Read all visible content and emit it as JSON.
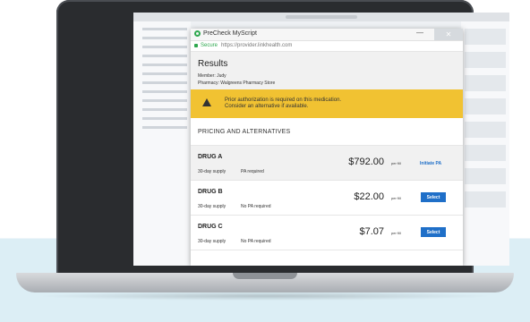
{
  "popup": {
    "app_name": "PreCheck MyScript",
    "minimize": "—",
    "close": "✕",
    "secure_label": "Secure",
    "url": "https://provider.linkhealth.com"
  },
  "results": {
    "title": "Results",
    "member": "Member: Judy",
    "pharmacy": "Pharmacy: Walgreens Pharmacy Store"
  },
  "alert": {
    "line1": "Prior authorization is required on this medication.",
    "line2": "Consider an alternative if available."
  },
  "pricing": {
    "section_title": "PRICING AND ALTERNATIVES",
    "drugs": [
      {
        "name": "DRUG A",
        "supply": "30-day supply",
        "pa": "PA required",
        "price": "$792.00",
        "per": "per fill",
        "action": "Initiate PA"
      },
      {
        "name": "DRUG B",
        "supply": "30-day supply",
        "pa": "No PA required",
        "price": "$22.00",
        "per": "per fill",
        "action": "Select"
      },
      {
        "name": "DRUG C",
        "supply": "30-day supply",
        "pa": "No PA required",
        "price": "$7.07",
        "per": "per fill",
        "action": "Select"
      }
    ]
  },
  "colors": {
    "warning": "#f1c232",
    "accent_blue": "#1f6fc8",
    "secure_green": "#2fa84f"
  }
}
